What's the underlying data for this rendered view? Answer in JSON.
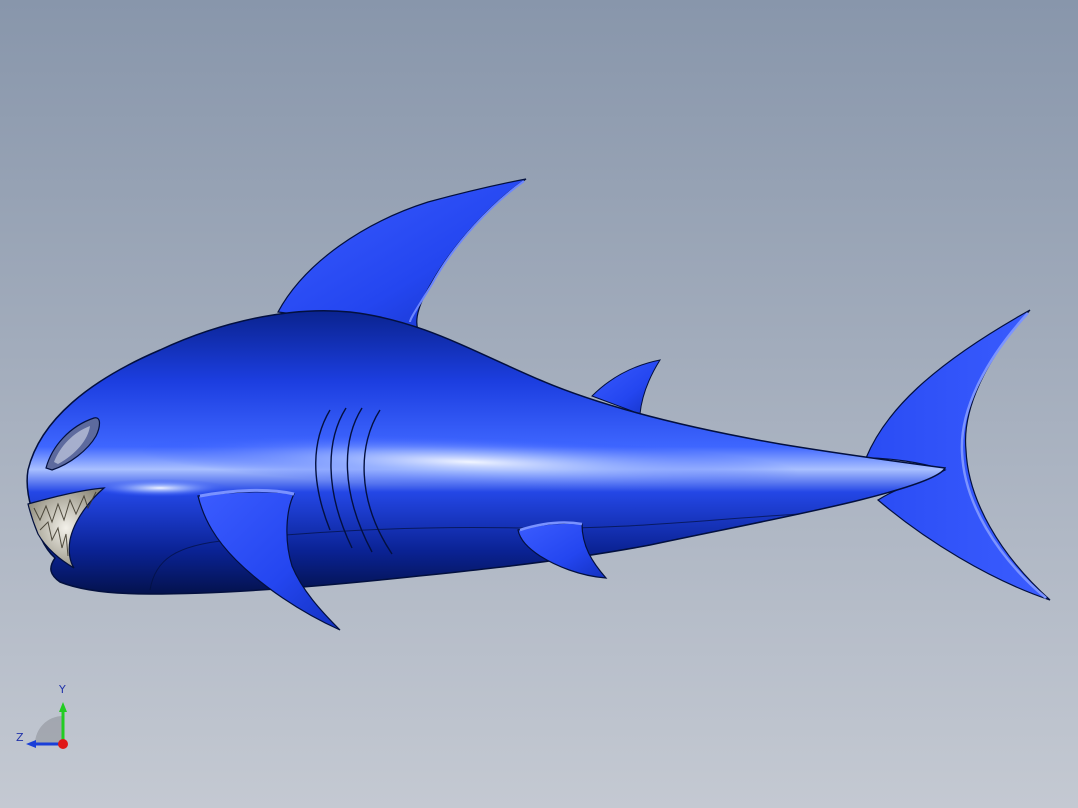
{
  "viewport": {
    "background_top": "#8896ab",
    "background_bottom": "#c4c9d2"
  },
  "model": {
    "name": "shark",
    "body_color": "#1c3ee0",
    "body_dark": "#061a6e",
    "highlight": "#dfe8ff",
    "edge_color": "#03103f",
    "teeth_color": "#d9d4c8"
  },
  "triad": {
    "y_label": "Y",
    "z_label": "Z",
    "y_color": "#22cc22",
    "z_color": "#1a3fd8",
    "x_color": "#e01818",
    "label_color": "#2233aa"
  }
}
